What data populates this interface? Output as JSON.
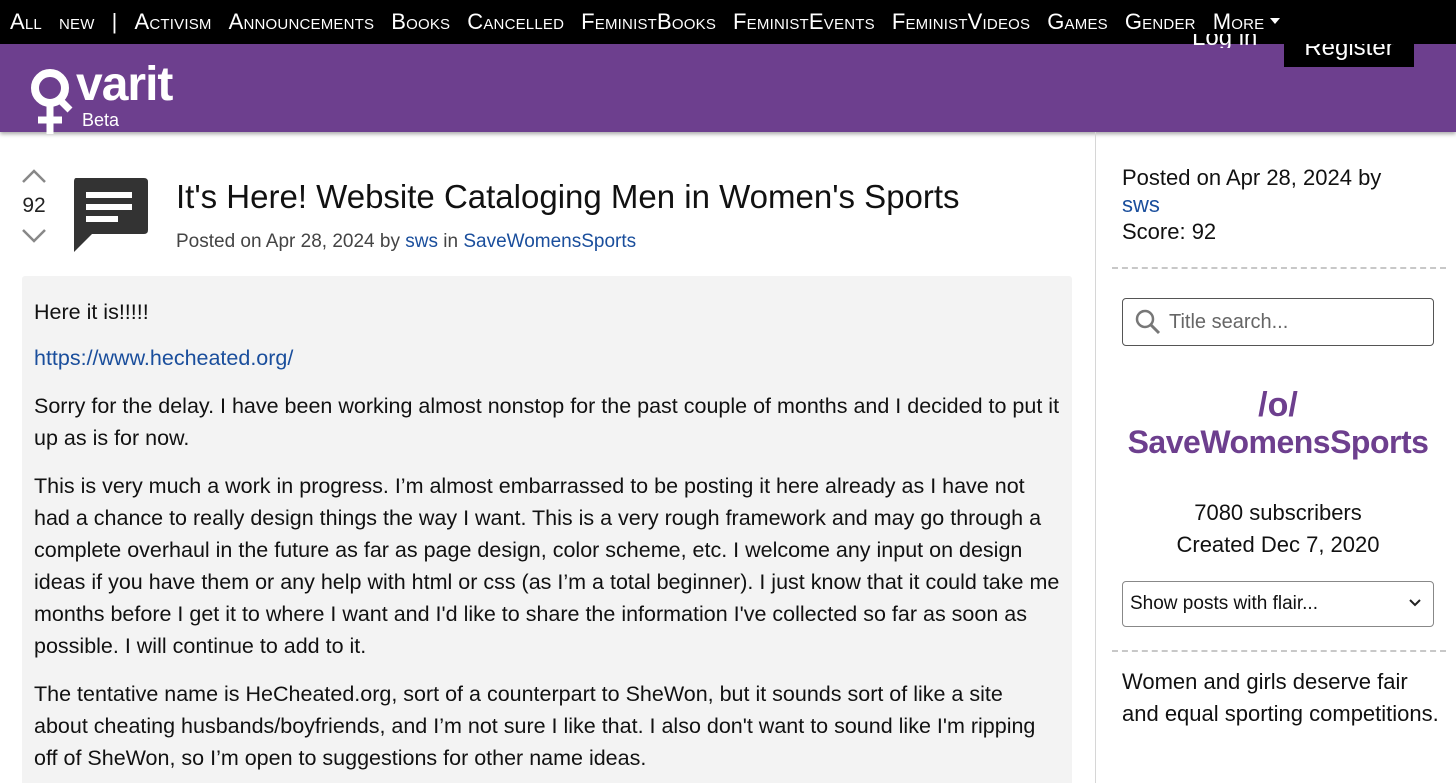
{
  "nav": {
    "items": [
      "All",
      "new",
      "|",
      "Activism",
      "Announcements",
      "Books",
      "Cancelled",
      "FeministBooks",
      "FeministEvents",
      "FeministVideos",
      "Games",
      "Gender"
    ],
    "more_label": "More"
  },
  "header": {
    "logo_text": "varit",
    "beta_label": "Beta",
    "login_label": "Log in",
    "register_label": "Register"
  },
  "colors": {
    "brand": "#6d3f8e",
    "link": "#1a4e9c"
  },
  "post": {
    "score": "92",
    "title": "It's Here! Website Cataloging Men in Women's Sports",
    "meta_prefix": "Posted on Apr 28, 2024 by",
    "author": "sws",
    "meta_in": "in",
    "community": "SaveWomensSports",
    "body": {
      "p1": "Here it is!!!!!",
      "link": "https://www.hecheated.org/",
      "p2": "Sorry for the delay. I have been working almost nonstop for the past couple of months and I decided to put it up as is for now.",
      "p3": "This is very much a work in progress. I’m almost embarrassed to be posting it here already as I have not had a chance to really design things the way I want. This is a very rough framework and may go through a complete overhaul in the future as far as page design, color scheme, etc. I welcome any input on design ideas if you have them or any help with html or css (as I’m a total beginner). I just know that it could take me months before I get it to where I want and I'd like to share the information I've collected so far as soon as possible. I will continue to add to it.",
      "p4": "The tentative name is HeCheated.org, sort of a counterpart to SheWon, but it sounds sort of like a site about cheating husbands/boyfriends, and I’m not sure I like that. I also don't want to sound like I'm ripping off of SheWon, so I’m open to suggestions for other name ideas."
    }
  },
  "sidebar": {
    "posted": "Posted on Apr 28, 2024 by",
    "author": "sws",
    "score": "Score: 92",
    "search_placeholder": "Title search...",
    "prefix": "/o/",
    "community": "SaveWomensSports",
    "subscribers": "7080 subscribers",
    "created": "Created Dec 7, 2020",
    "flair_label": "Show posts with flair...",
    "description": "Women and girls deserve fair and equal sporting competitions."
  }
}
